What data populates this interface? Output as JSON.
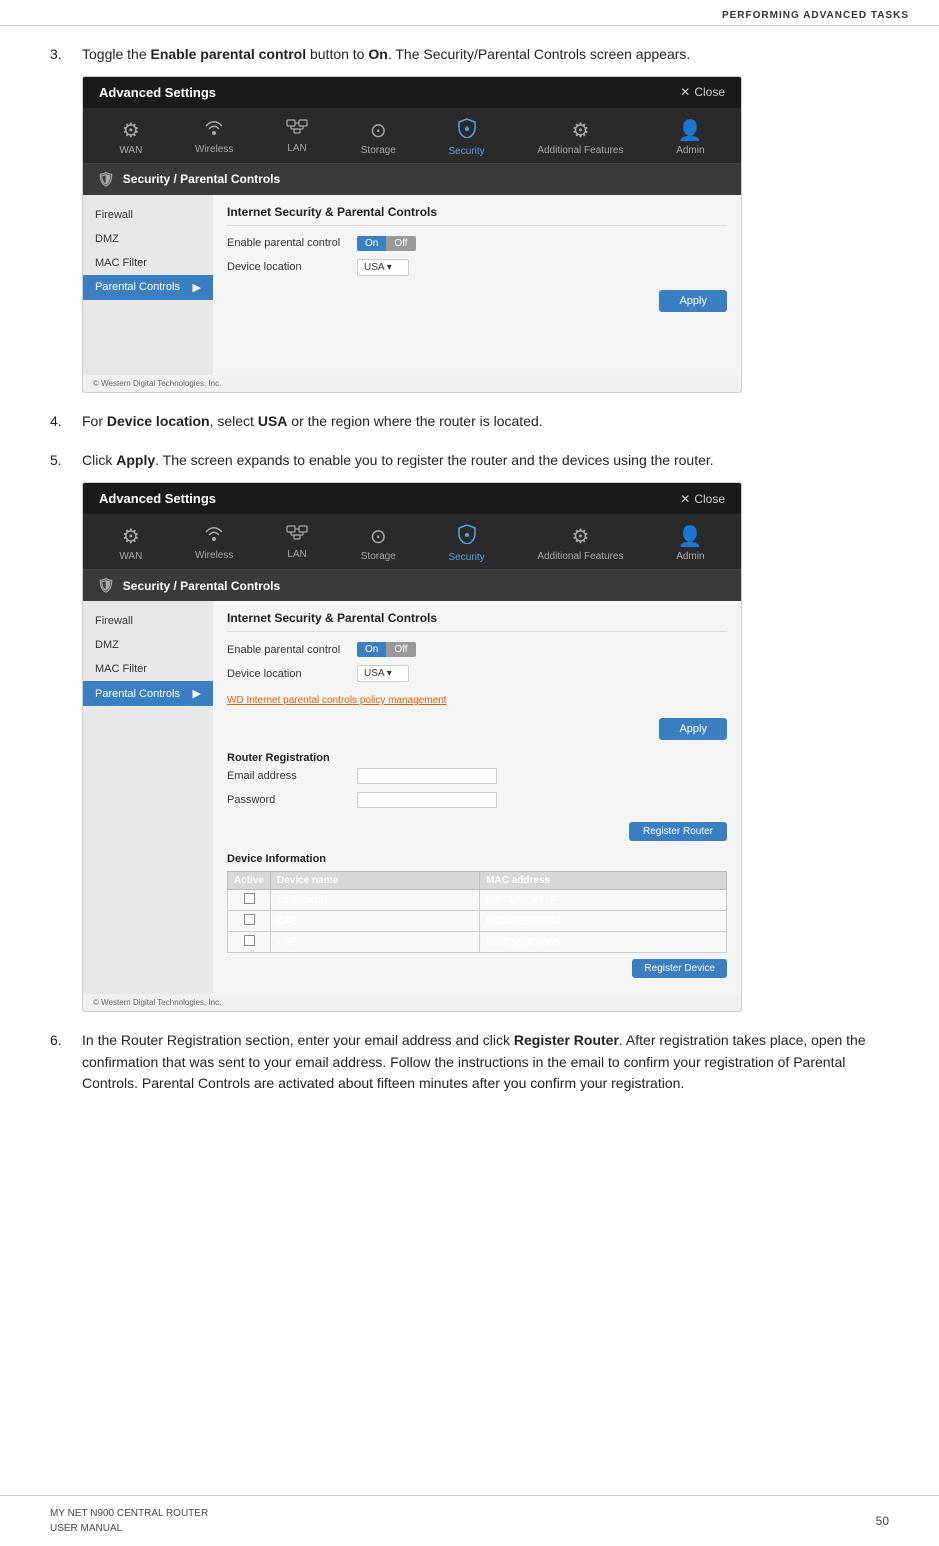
{
  "header": {
    "title": "PERFORMING ADVANCED TASKS"
  },
  "steps": [
    {
      "num": "3.",
      "text_before": "Toggle the ",
      "bold1": "Enable parental control",
      "text_mid": " button to ",
      "bold2": "On",
      "text_after": ". The Security/Parental Controls screen appears."
    },
    {
      "num": "4.",
      "text": "For ",
      "bold1": "Device location",
      "text_mid": ", select ",
      "bold2": "USA",
      "text_after": " or the region where the router is located."
    },
    {
      "num": "5.",
      "text_before": "Click ",
      "bold1": "Apply",
      "text_after": ". The screen expands to enable you to register the router and the devices using the router."
    },
    {
      "num": "6.",
      "text_before": "In the Router Registration section, enter your email address and click ",
      "bold1": "Register Router",
      "text_after": ". After registration takes place, open the confirmation that was sent to your email address. Follow the instructions in the email to confirm your registration of Parental Controls. Parental Controls are activated about fifteen minutes after you confirm your registration."
    }
  ],
  "screenshot1": {
    "header_title": "Advanced Settings",
    "close_label": "Close",
    "nav_items": [
      {
        "label": "WAN",
        "icon": "⚙",
        "active": false
      },
      {
        "label": "Wireless",
        "icon": "📶",
        "active": false
      },
      {
        "label": "LAN",
        "icon": "🖥",
        "active": false
      },
      {
        "label": "Storage",
        "icon": "⊙",
        "active": false
      },
      {
        "label": "Security",
        "icon": "🛡",
        "active": true
      },
      {
        "label": "Additional Features",
        "icon": "⚙",
        "active": false
      },
      {
        "label": "Admin",
        "icon": "👤",
        "active": false
      }
    ],
    "section_title": "Security / Parental Controls",
    "left_menu": [
      "Firewall",
      "DMZ",
      "MAC Filter",
      "Parental Controls"
    ],
    "active_menu": "Parental Controls",
    "panel_title": "Internet Security & Parental Controls",
    "form_rows": [
      {
        "label": "Enable parental control",
        "control": "toggle",
        "value": "On"
      },
      {
        "label": "Device location",
        "control": "select",
        "value": "USA"
      }
    ],
    "apply_label": "Apply",
    "footer": "© Western Digital Technologies, Inc."
  },
  "screenshot2": {
    "header_title": "Advanced Settings",
    "close_label": "Close",
    "nav_items": [
      {
        "label": "WAN",
        "icon": "⚙",
        "active": false
      },
      {
        "label": "Wireless",
        "icon": "📶",
        "active": false
      },
      {
        "label": "LAN",
        "icon": "🖥",
        "active": false
      },
      {
        "label": "Storage",
        "icon": "⊙",
        "active": false
      },
      {
        "label": "Security",
        "icon": "🛡",
        "active": true
      },
      {
        "label": "Additional Features",
        "icon": "⚙",
        "active": false
      },
      {
        "label": "Admin",
        "icon": "👤",
        "active": false
      }
    ],
    "section_title": "Security / Parental Controls",
    "left_menu": [
      "Firewall",
      "DMZ",
      "MAC Filter",
      "Parental Controls"
    ],
    "active_menu": "Parental Controls",
    "panel_title": "Internet Security & Parental Controls",
    "form_rows": [
      {
        "label": "Enable parental control",
        "control": "toggle",
        "value": "On"
      },
      {
        "label": "Device location",
        "control": "select",
        "value": "USA"
      }
    ],
    "link_text": "WD Internet parental controls policy management",
    "apply_label": "Apply",
    "router_reg_title": "Router Registration",
    "email_label": "Email address",
    "password_label": "Password",
    "register_router_label": "Register Router",
    "device_info_title": "Device Information",
    "device_table_headers": [
      "Active",
      "Device name",
      "MAC address"
    ],
    "device_table_rows": [
      {
        "active": false,
        "name": "(unknown)",
        "mac": "8887179CB79F"
      },
      {
        "active": false,
        "name": "CAE",
        "mac": "BC305BBEC533"
      },
      {
        "active": false,
        "name": "CAE",
        "mac": "BC305BBC0365"
      }
    ],
    "register_device_label": "Register Device",
    "footer": "© Western Digital Technologies, Inc."
  },
  "page_footer": {
    "left": "MY NET N900 CENTRAL ROUTER\nUSER MANUAL",
    "right": "50"
  }
}
